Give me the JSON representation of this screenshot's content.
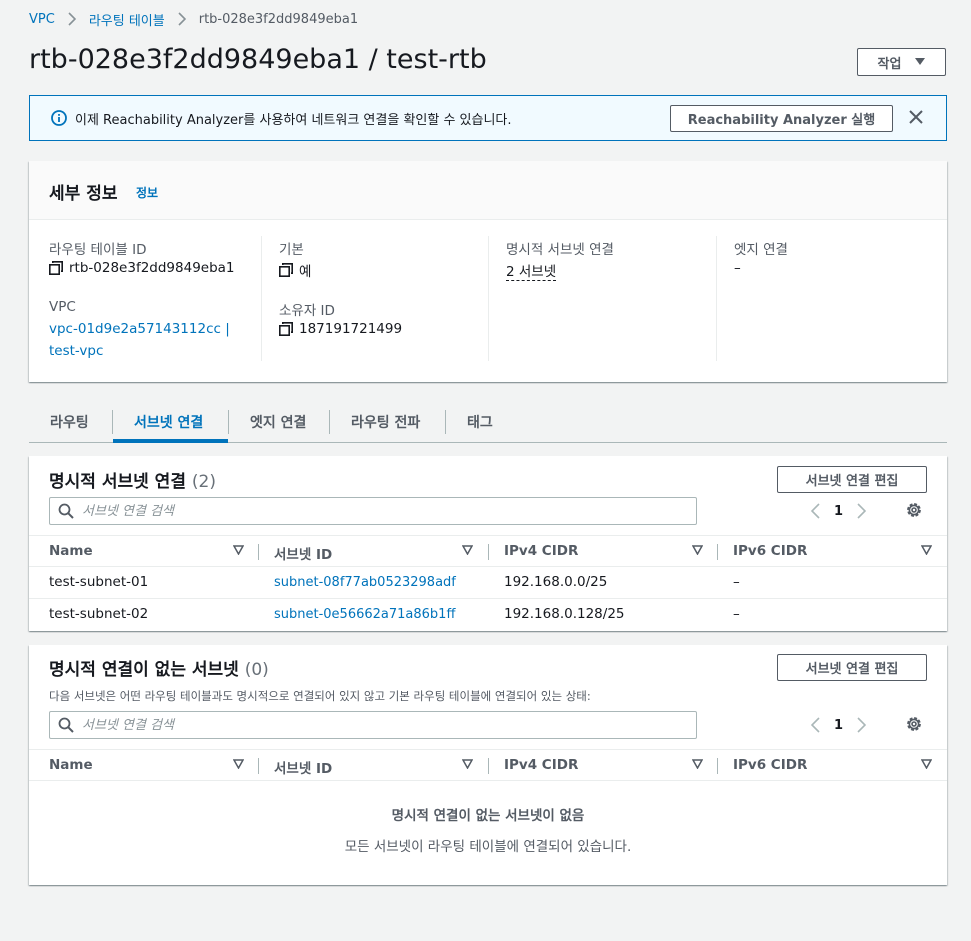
{
  "breadcrumb": {
    "vpc": "VPC",
    "route_tables": "라우팅 테이블",
    "current": "rtb-028e3f2dd9849eba1"
  },
  "page": {
    "title": "rtb-028e3f2dd9849eba1 / test-rtb",
    "actions_label": "작업"
  },
  "banner": {
    "message": "이제 Reachability Analyzer를 사용하여 네트워크 연결을 확인할 수 있습니다.",
    "button_label": "Reachability Analyzer 실행"
  },
  "details": {
    "title": "세부 정보",
    "info_link": "정보",
    "route_table_id_label": "라우팅 테이블 ID",
    "route_table_id_value": "rtb-028e3f2dd9849eba1",
    "vpc_label": "VPC",
    "vpc_value_line1": "vpc-01d9e2a57143112cc |",
    "vpc_value_line2": "test-vpc",
    "main_label": "기본",
    "main_value": "예",
    "owner_label": "소유자 ID",
    "owner_value": "187191721499",
    "explicit_label": "명시적 서브넷 연결",
    "explicit_value": "2 서브넷",
    "edge_label": "엣지 연결",
    "edge_value": "–"
  },
  "tabs": [
    {
      "label": "라우팅"
    },
    {
      "label": "서브넷 연결"
    },
    {
      "label": "엣지 연결"
    },
    {
      "label": "라우팅 전파"
    },
    {
      "label": "태그"
    }
  ],
  "explicit_table": {
    "title": "명시적 서브넷 연결",
    "count": "(2)",
    "edit_label": "서브넷 연결 편집",
    "search_placeholder": "서브넷 연결 검색",
    "page": "1",
    "columns": [
      "Name",
      "서브넷 ID",
      "IPv4 CIDR",
      "IPv6 CIDR"
    ],
    "rows": [
      {
        "name": "test-subnet-01",
        "subnet_id": "subnet-08f77ab0523298adf",
        "ipv4": "192.168.0.0/25",
        "ipv6": "–"
      },
      {
        "name": "test-subnet-02",
        "subnet_id": "subnet-0e56662a71a86b1ff",
        "ipv4": "192.168.0.128/25",
        "ipv6": "–"
      }
    ]
  },
  "implicit_table": {
    "title": "명시적 연결이 없는 서브넷",
    "count": "(0)",
    "edit_label": "서브넷 연결 편집",
    "description": "다음 서브넷은 어떤 라우팅 테이블과도 명시적으로 연결되어 있지 않고 기본 라우팅 테이블에 연결되어 있는 상태:",
    "search_placeholder": "서브넷 연결 검색",
    "page": "1",
    "columns": [
      "Name",
      "서브넷 ID",
      "IPv4 CIDR",
      "IPv6 CIDR"
    ],
    "empty_title": "명시적 연결이 없는 서브넷이 없음",
    "empty_sub": "모든 서브넷이 라우팅 테이블에 연결되어 있습니다."
  },
  "colors": {
    "link": "#0073bb",
    "banner_bg": "#f1faff",
    "text": "#16191f",
    "muted": "#545b64"
  }
}
